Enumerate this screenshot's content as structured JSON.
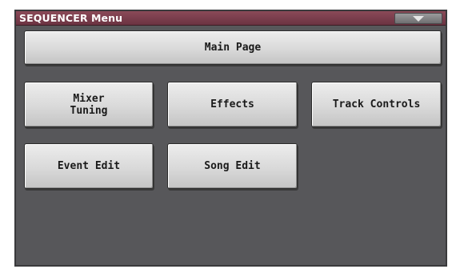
{
  "window": {
    "title": "SEQUENCER Menu",
    "menu_arrow_icon": "triangle-down-icon"
  },
  "buttons": {
    "main_page": "Main Page",
    "mixer_tuning": "Mixer\nTuning",
    "effects": "Effects",
    "track_controls": "Track Controls",
    "event_edit": "Event Edit",
    "song_edit": "Song Edit"
  },
  "colors": {
    "title_bar": "#7a3d4c",
    "background": "#57575a",
    "button_face": "#d9d9d9",
    "button_text": "#1a1a1a"
  }
}
